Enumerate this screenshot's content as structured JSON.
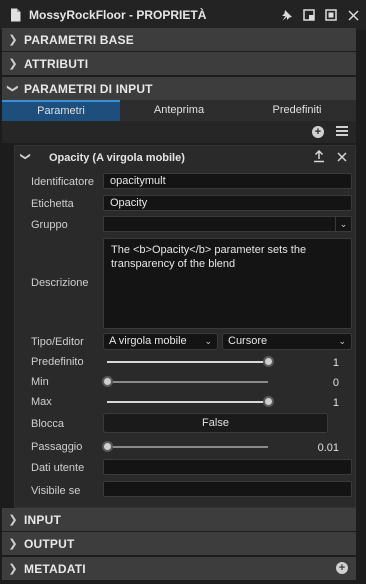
{
  "window": {
    "title": "MossyRockFloor - PROPRIETÀ"
  },
  "sections": {
    "base": "PARAMETRI BASE",
    "attributes": "ATTRIBUTI",
    "input_params": "PARAMETRI DI INPUT",
    "input": "INPUT",
    "output": "OUTPUT",
    "metadata": "METADATI"
  },
  "tabs": [
    "Parametri",
    "Anteprima",
    "Predefiniti"
  ],
  "param": {
    "name": "Opacity (A virgola mobile)",
    "labels": {
      "identifier": "Identificatore",
      "label": "Etichetta",
      "group": "Gruppo",
      "description": "Descrizione",
      "type_editor": "Tipo/Editor",
      "default": "Predefinito",
      "min": "Min",
      "max": "Max",
      "lock": "Blocca",
      "step": "Passaggio",
      "user_data": "Dati utente",
      "visible_if": "Visibile se"
    },
    "identifier": "opacitymult",
    "label": "Opacity",
    "group": "",
    "description": "The <b>Opacity</b> parameter sets the transparency of the blend",
    "type": "A virgola mobile",
    "editor": "Cursore",
    "default_value": "1",
    "default_fraction": 1.0,
    "min_value": "0",
    "min_fraction": 0.0,
    "max_value": "1",
    "max_fraction": 1.0,
    "lock_value": "False",
    "step_value": "0.01",
    "step_fraction": 0.0,
    "user_data": "",
    "visible_if": ""
  },
  "colors": {
    "accent_tab": "#1e4f7c",
    "section_bg": "#3d3d3d"
  }
}
